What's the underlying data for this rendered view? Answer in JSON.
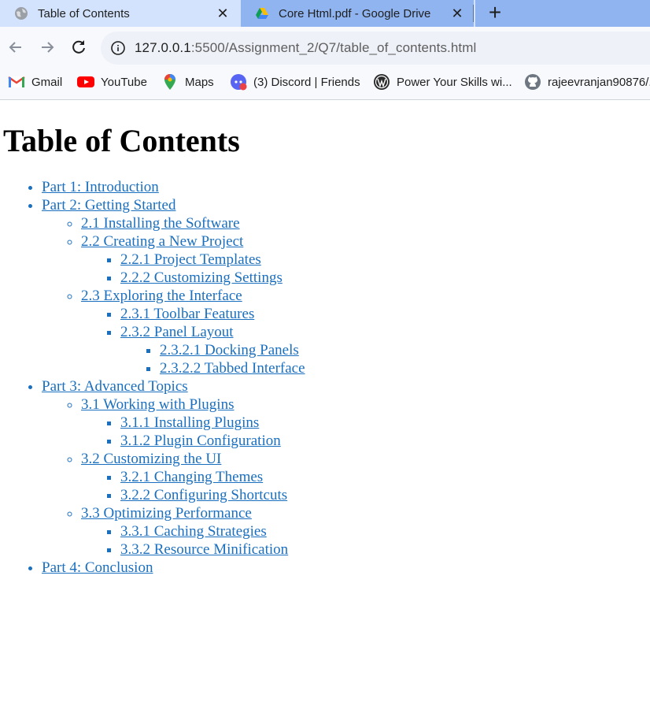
{
  "browser": {
    "tabs": [
      {
        "title": "Table of Contents",
        "icon": "globe-icon",
        "active": true
      },
      {
        "title": "Core Html.pdf - Google Drive",
        "icon": "google-drive-icon",
        "active": false
      }
    ],
    "url_host": "127.0.0.1",
    "url_rest": ":5500/Assignment_2/Q7/table_of_contents.html",
    "bookmarks": [
      {
        "label": "Gmail",
        "icon": "gmail-icon"
      },
      {
        "label": "YouTube",
        "icon": "youtube-icon"
      },
      {
        "label": "Maps",
        "icon": "maps-icon"
      },
      {
        "label": "(3) Discord | Friends",
        "icon": "discord-icon"
      },
      {
        "label": "Power Your Skills wi...",
        "icon": "wordpress-icon"
      },
      {
        "label": "rajeevranjan90876/...",
        "icon": "github-icon"
      }
    ]
  },
  "page": {
    "title": "Table of Contents",
    "toc": {
      "part1": "Part 1: Introduction",
      "part2": {
        "label": "Part 2: Getting Started",
        "s2_1": "2.1 Installing the Software",
        "s2_2": {
          "label": "2.2 Creating a New Project",
          "s2_2_1": "2.2.1 Project Templates",
          "s2_2_2": "2.2.2 Customizing Settings"
        },
        "s2_3": {
          "label": "2.3 Exploring the Interface",
          "s2_3_1": "2.3.1 Toolbar Features",
          "s2_3_2": {
            "label": "2.3.2 Panel Layout",
            "s2_3_2_1": "2.3.2.1 Docking Panels",
            "s2_3_2_2": "2.3.2.2 Tabbed Interface"
          }
        }
      },
      "part3": {
        "label": "Part 3: Advanced Topics",
        "s3_1": {
          "label": "3.1 Working with Plugins",
          "s3_1_1": "3.1.1 Installing Plugins",
          "s3_1_2": "3.1.2 Plugin Configuration"
        },
        "s3_2": {
          "label": "3.2 Customizing the UI",
          "s3_2_1": "3.2.1 Changing Themes",
          "s3_2_2": "3.2.2 Configuring Shortcuts"
        },
        "s3_3": {
          "label": "3.3 Optimizing Performance",
          "s3_3_1": "3.3.1 Caching Strategies",
          "s3_3_2": "3.3.2 Resource Minification"
        }
      },
      "part4": "Part 4: Conclusion"
    }
  },
  "colors": {
    "link": "#1a6fbf",
    "chrome_bg": "#d3e3fd",
    "inactive_tab": "#8fb4ef"
  }
}
